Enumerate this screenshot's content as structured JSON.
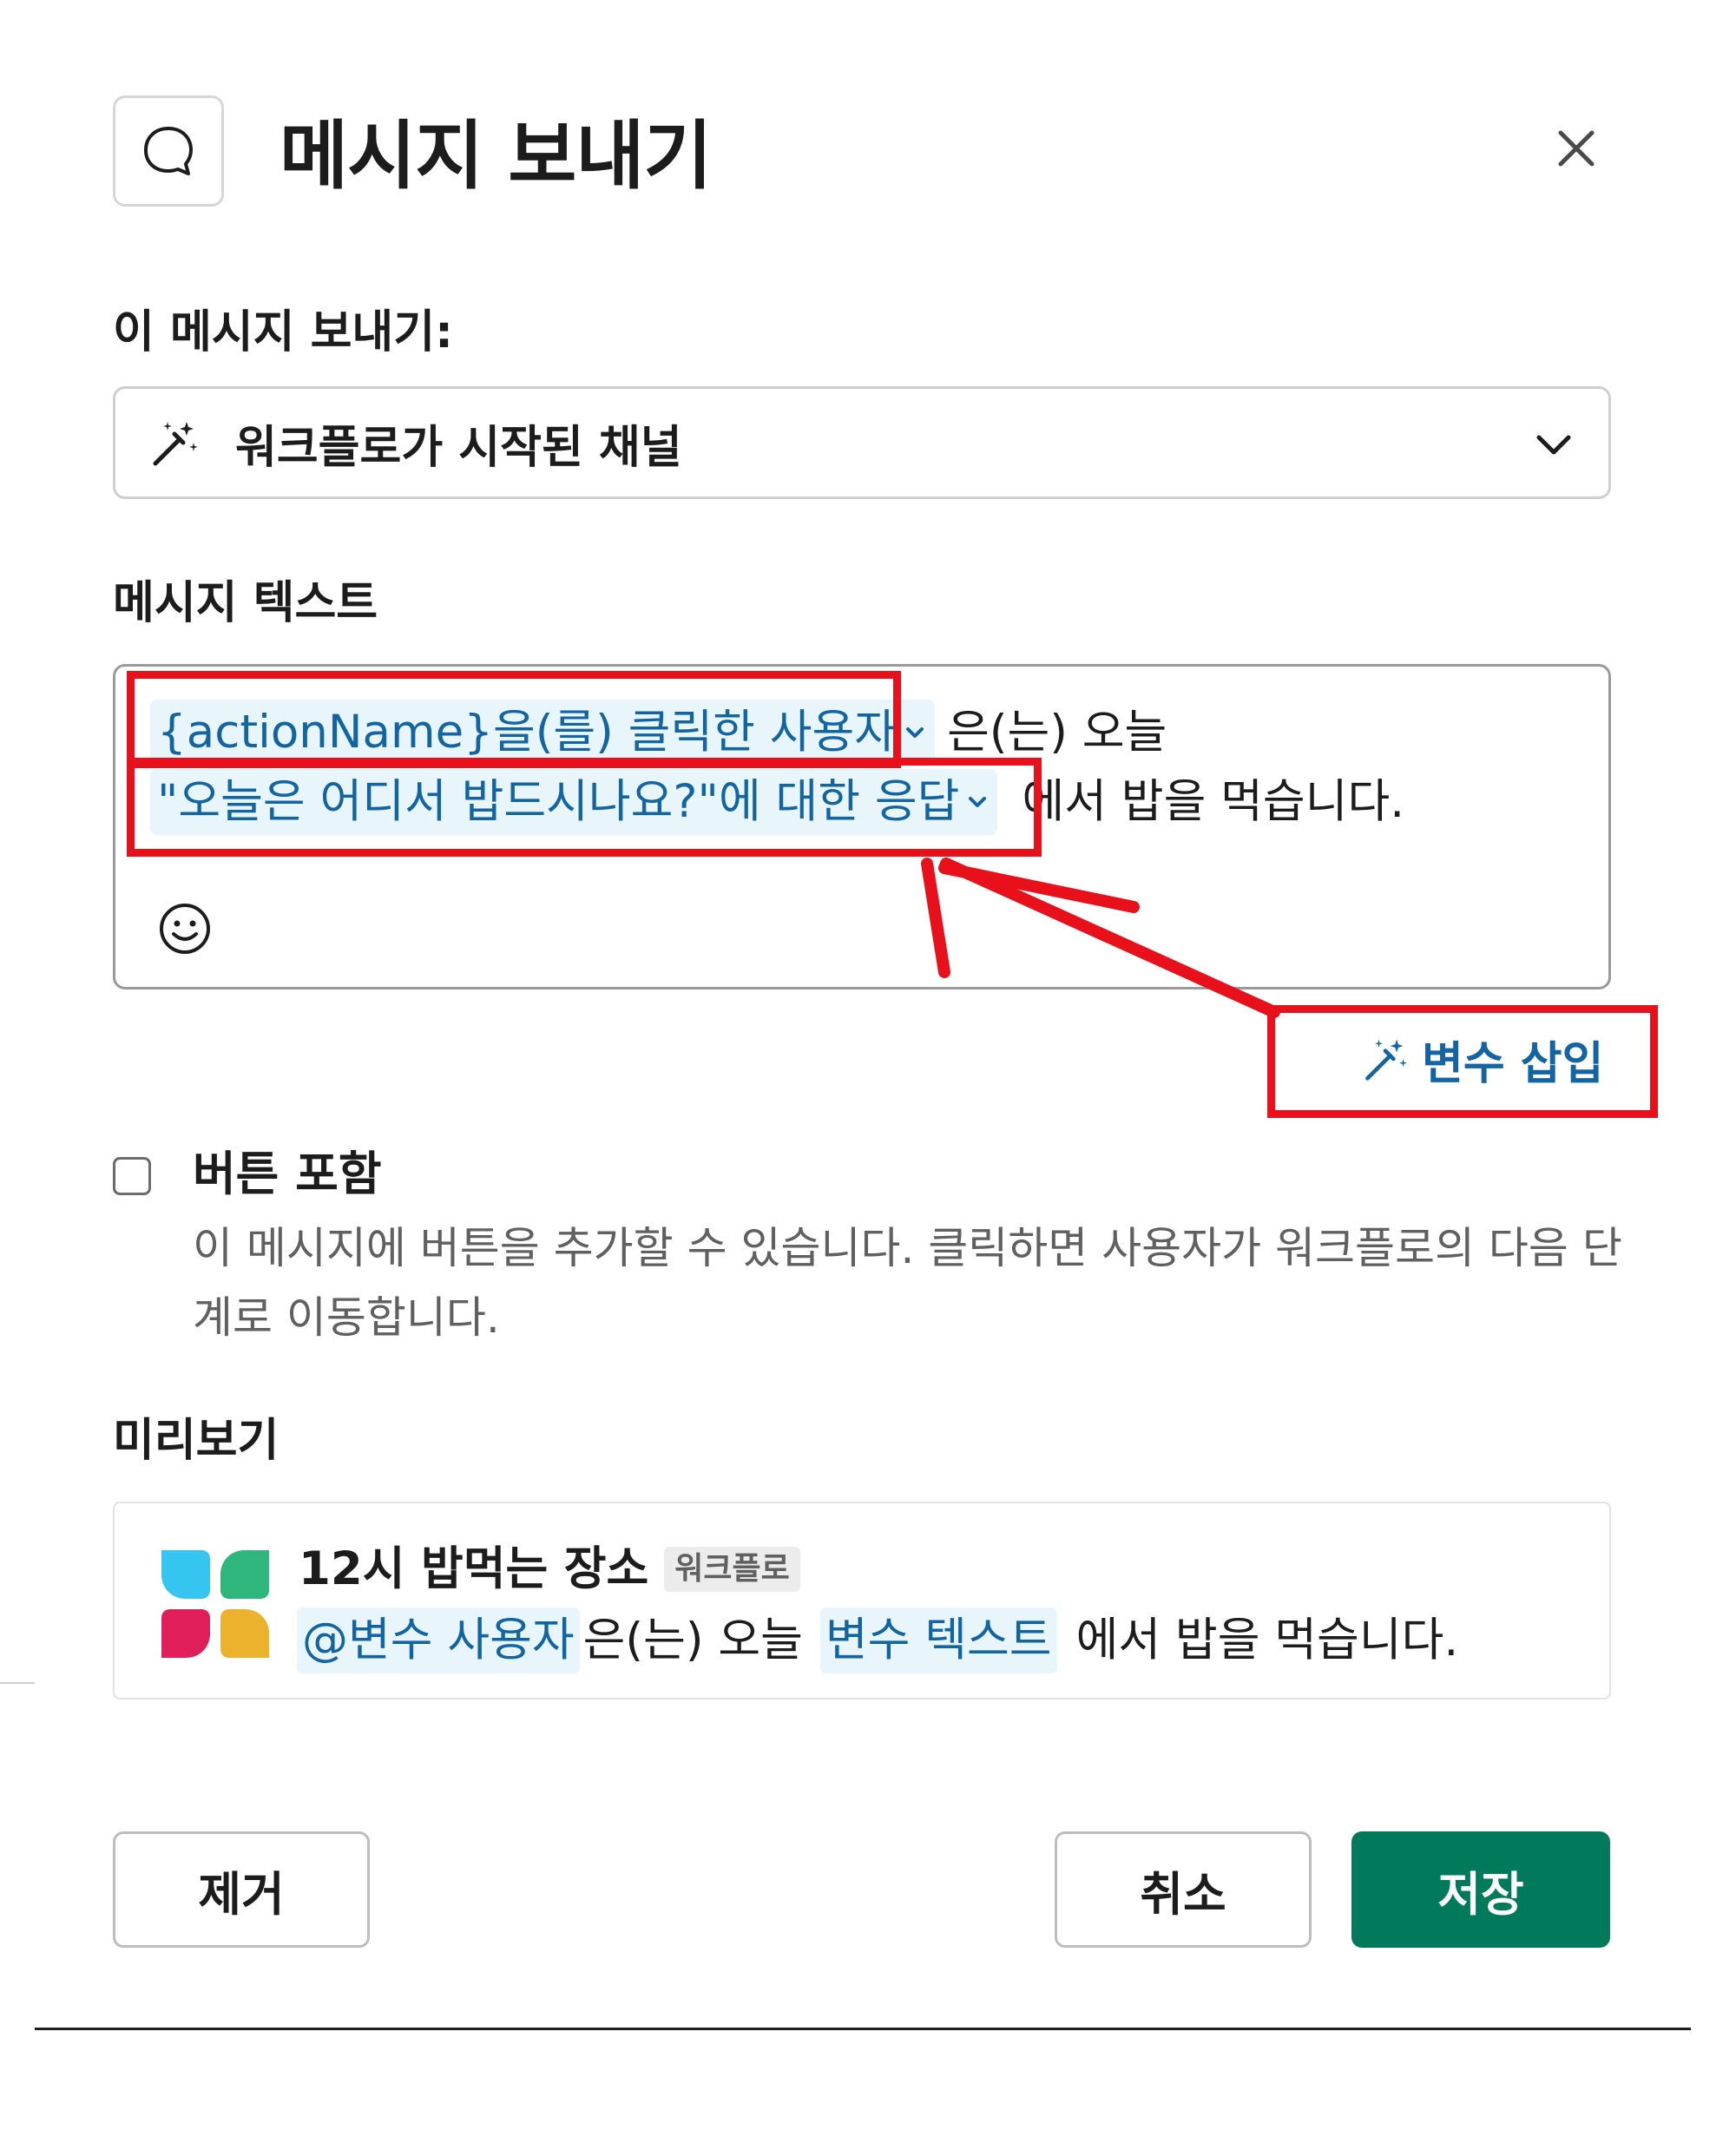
{
  "modal": {
    "title": "메시지 보내기",
    "send_to_label": "이 메시지 보내기:",
    "send_to_value": "워크플로가 시작된 채널",
    "message_text_label": "메시지 텍스트",
    "message": {
      "variable_1": "{actionName}을(를) 클릭한 사용자",
      "text_1": "은(는) 오늘",
      "variable_2": "\"오늘은 어디서 밥드시나요?\"에 대한 응답",
      "text_2": "에서 밥을 먹습니다."
    },
    "insert_variable": "변수 삽입",
    "include_button_label": "버튼 포함",
    "include_button_desc": "이 메시지에 버튼을 추가할 수 있습니다. 클릭하면 사용자가 워크플로의 다음 단계로 이동합니다.",
    "preview_label": "미리보기",
    "preview": {
      "sender": "12시 밥먹는 장소",
      "badge": "워크플로",
      "mention_user": "@변수 사용자",
      "text_1": "은(는) 오늘",
      "mention_text": "변수 텍스트",
      "text_2": "에서 밥을 먹습니다."
    },
    "buttons": {
      "remove": "제거",
      "cancel": "취소",
      "save": "저장"
    }
  },
  "colors": {
    "primary": "#007a5a",
    "link": "#1264a3",
    "annotation": "#e8111b",
    "variable_bg": "#e8f5fa"
  }
}
